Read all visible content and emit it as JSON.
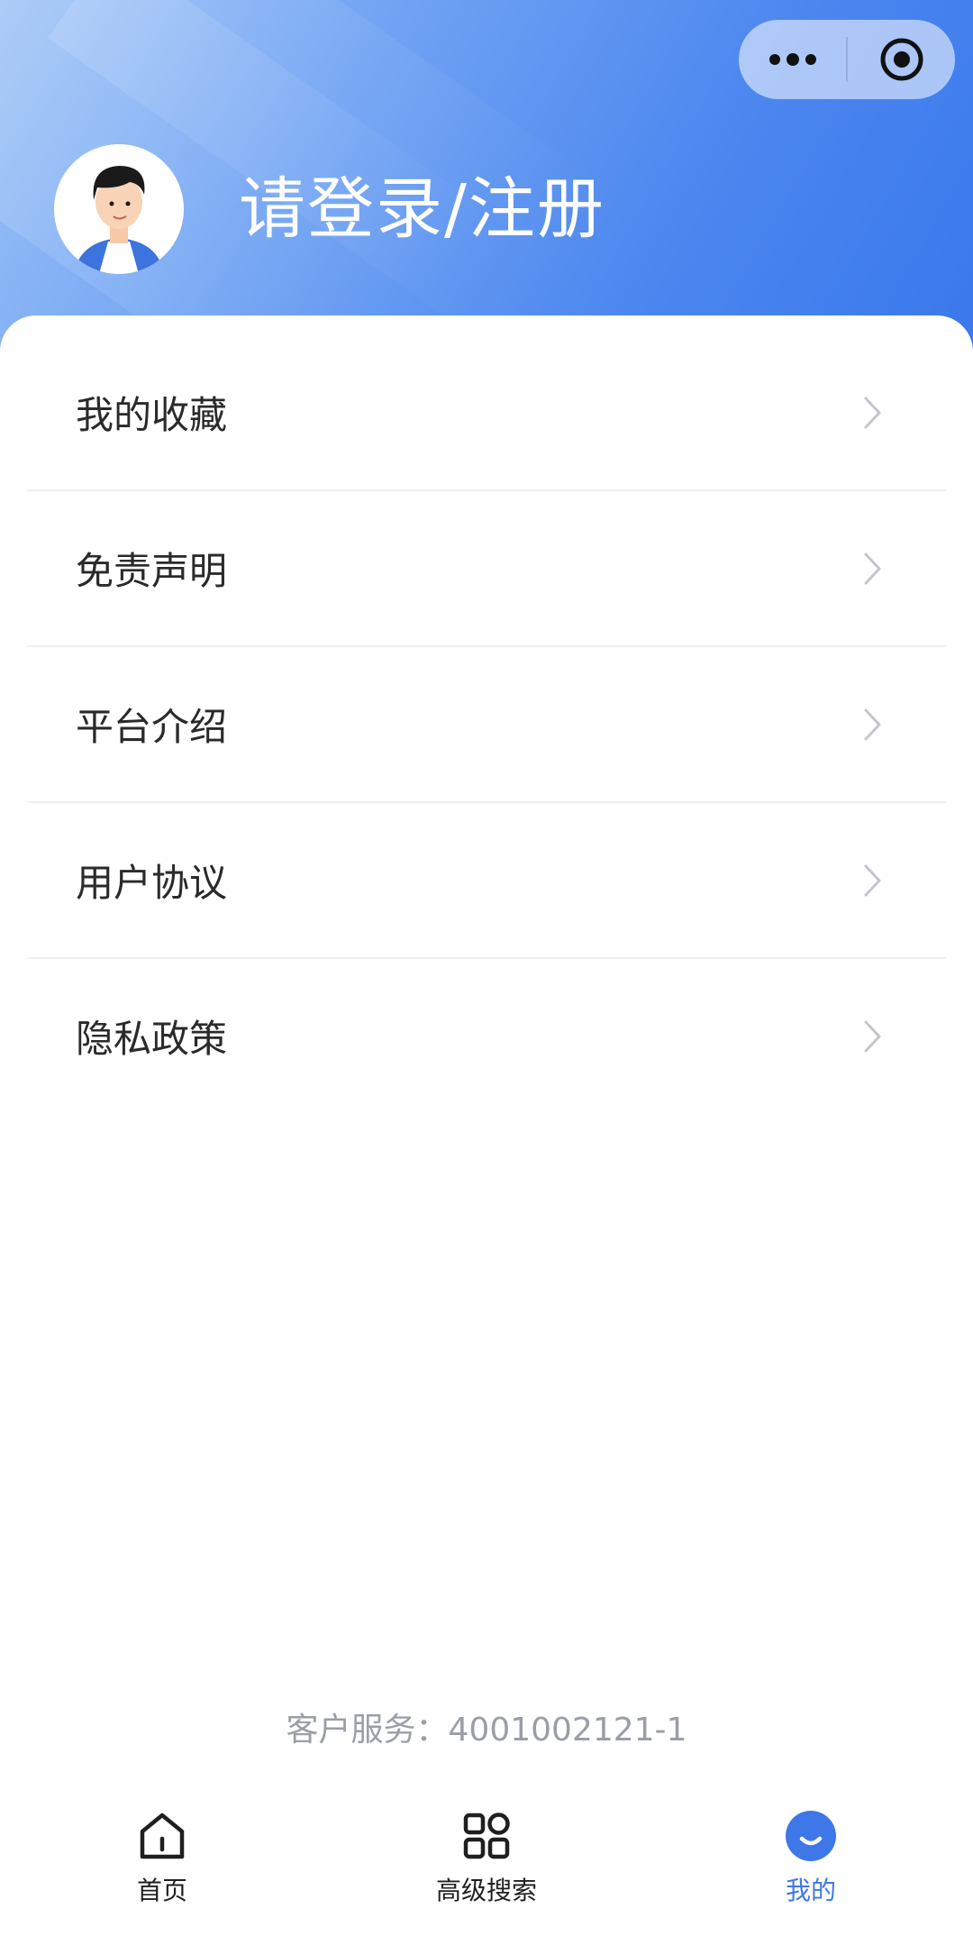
{
  "header": {
    "login_title": "请登录/注册"
  },
  "capsule": {
    "more_icon": "more-dots-icon",
    "close_icon": "target-close-icon"
  },
  "menu": {
    "items": [
      {
        "label": "我的收藏"
      },
      {
        "label": "免责声明"
      },
      {
        "label": "平台介绍"
      },
      {
        "label": "用户协议"
      },
      {
        "label": "隐私政策"
      }
    ]
  },
  "footer": {
    "service_text": "客户服务：4001002121-1"
  },
  "tabbar": {
    "tabs": [
      {
        "label": "首页",
        "icon": "home-icon"
      },
      {
        "label": "高级搜索",
        "icon": "grid-icon"
      },
      {
        "label": "我的",
        "icon": "smile-icon",
        "active": true
      }
    ]
  },
  "colors": {
    "accent": "#3e77e8",
    "header_gradient_start": "#9cc2f6",
    "header_gradient_end": "#3a78ec"
  }
}
